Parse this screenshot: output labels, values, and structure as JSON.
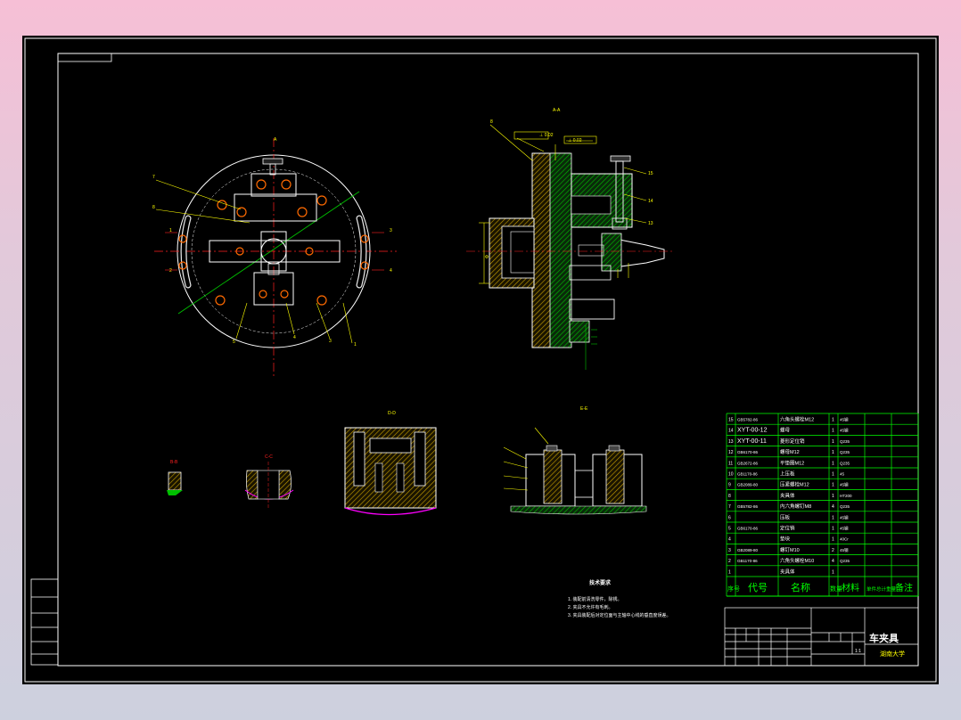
{
  "drawing": {
    "title": "车夹具",
    "school": "湖南大学",
    "scale": "1:1"
  },
  "left_strip": [
    "",
    "",
    "",
    "",
    "",
    ""
  ],
  "bom": {
    "header": [
      "序号",
      "代号",
      "名称",
      "数量",
      "材料",
      "单件总计重量",
      "备注"
    ],
    "rows": [
      [
        "15",
        "GB5782-86",
        "六角头螺栓M12",
        "1",
        "45钢",
        ""
      ],
      [
        "14",
        "XYT-00-12",
        "螺母",
        "1",
        "45钢",
        ""
      ],
      [
        "13",
        "XYT-00-11",
        "菱形定位销",
        "1",
        "Q235",
        ""
      ],
      [
        "12",
        "GB6170-86",
        "螺母M12",
        "1",
        "Q235",
        ""
      ],
      [
        "11",
        "GB2672-86",
        "平垫圈M12",
        "1",
        "Q235",
        ""
      ],
      [
        "10",
        "GB1170-86",
        "上压板",
        "1",
        "45",
        ""
      ],
      [
        "9",
        "GB2089-80",
        "压紧螺栓M12",
        "1",
        "45钢",
        ""
      ],
      [
        "8",
        "",
        "夹具体",
        "1",
        "HT200",
        ""
      ],
      [
        "7",
        "GB5782-86",
        "内六角螺钉M8",
        "4",
        "Q235",
        ""
      ],
      [
        "6",
        "",
        "压板",
        "1",
        "45钢",
        ""
      ],
      [
        "5",
        "GB6170-86",
        "定位销",
        "1",
        "45钢",
        ""
      ],
      [
        "4",
        "",
        "垫块",
        "1",
        "40Cr",
        ""
      ],
      [
        "3",
        "GB2089-80",
        "螺钉M10",
        "2",
        "45钢",
        ""
      ],
      [
        "2",
        "GB1170-86",
        "六角头螺栓M10",
        "4",
        "Q235",
        ""
      ],
      [
        "1",
        "",
        "夹具体",
        "1",
        "",
        ""
      ]
    ]
  },
  "notes": {
    "title": "技术要求",
    "lines": [
      "1. 装配前清洗零件，除锈。",
      "2. 夹具不允许有毛刺。",
      "3. 夹具装配后对定位面与主轴中心线的垂直度误差。"
    ]
  },
  "views": {
    "main_label": "A",
    "side_label": "A-A",
    "detail1": "B-B",
    "detail2": "C-C",
    "section": "D-D",
    "assembly": "E-E"
  },
  "colors": {
    "frame": "#ffffff",
    "yellow": "#ffff00",
    "green": "#00c000",
    "red": "#ff2020",
    "magenta": "#ff00ff",
    "table": "#00ff00"
  }
}
